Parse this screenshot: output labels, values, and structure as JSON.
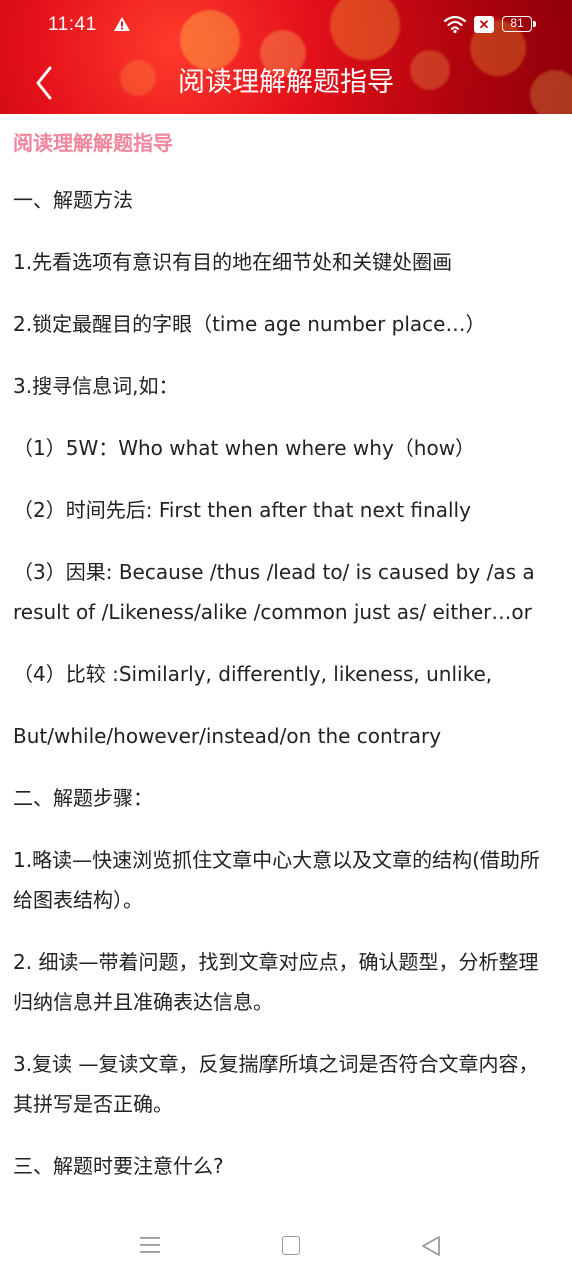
{
  "status_bar": {
    "time": "11:41",
    "sim_label": "✕",
    "battery": "81",
    "icons": [
      "warning-icon",
      "wifi-icon",
      "sim-icon",
      "battery-icon"
    ]
  },
  "header": {
    "title": "阅读理解解题指导",
    "back_icon": "chevron-left-icon",
    "background_color": "#c8101a"
  },
  "content": {
    "doc_title": "阅读理解解题指导",
    "doc_title_color": "#f0859b",
    "paragraphs": [
      "一、解题方法",
      "1.先看选项有意识有目的地在细节处和关键处圈画",
      "2.锁定最醒目的字眼（time age number place…）",
      "3.搜寻信息词,如：",
      "（1）5W：Who what when where why（how）",
      "（2）时间先后: First then after that next finally",
      "（3）因果: Because /thus /lead to/ is caused by /as a result of /Likeness/alike /common just as/ either…or",
      "（4）比较 :Similarly, differently, likeness, unlike,",
      "But/while/however/instead/on the contrary",
      "二、解题步骤：",
      "1.略读—快速浏览抓住文章中心大意以及文章的结构(借助所给图表结构）。",
      "2. 细读—带着问题，找到文章对应点，确认题型，分析整理归纳信息并且准确表达信息。",
      "3.复读 —复读文章，反复揣摩所填之词是否符合文章内容，其拼写是否正确。",
      "三、解题时要注意什么?"
    ]
  },
  "nav_bar": {
    "icons": [
      "menu-icon",
      "home-square-icon",
      "back-triangle-icon"
    ]
  }
}
